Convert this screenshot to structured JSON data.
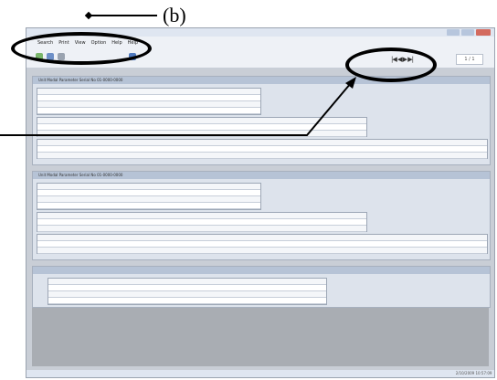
{
  "annotation": {
    "label": "(b)"
  },
  "menu": {
    "items": [
      "Search",
      "Print",
      "View",
      "Option",
      "Help",
      "Help"
    ]
  },
  "toolbar": {
    "nav_glyphs": "|◀ ◀ ▶ ▶|",
    "page_field": "1 / 1"
  },
  "panels": {
    "first_title": "Unit Modal Parameter  Serial No 01-0000-0000",
    "second_title": "Unit Modal Parameter  Serial No 01-0000-0000"
  },
  "status": {
    "clock": "2/10/2009 10:57:09"
  },
  "colors": {
    "frame": "#c9ced6",
    "panel": "#dde3ec",
    "header": "#b6c3d6",
    "dark_area": "#a9adb3"
  }
}
